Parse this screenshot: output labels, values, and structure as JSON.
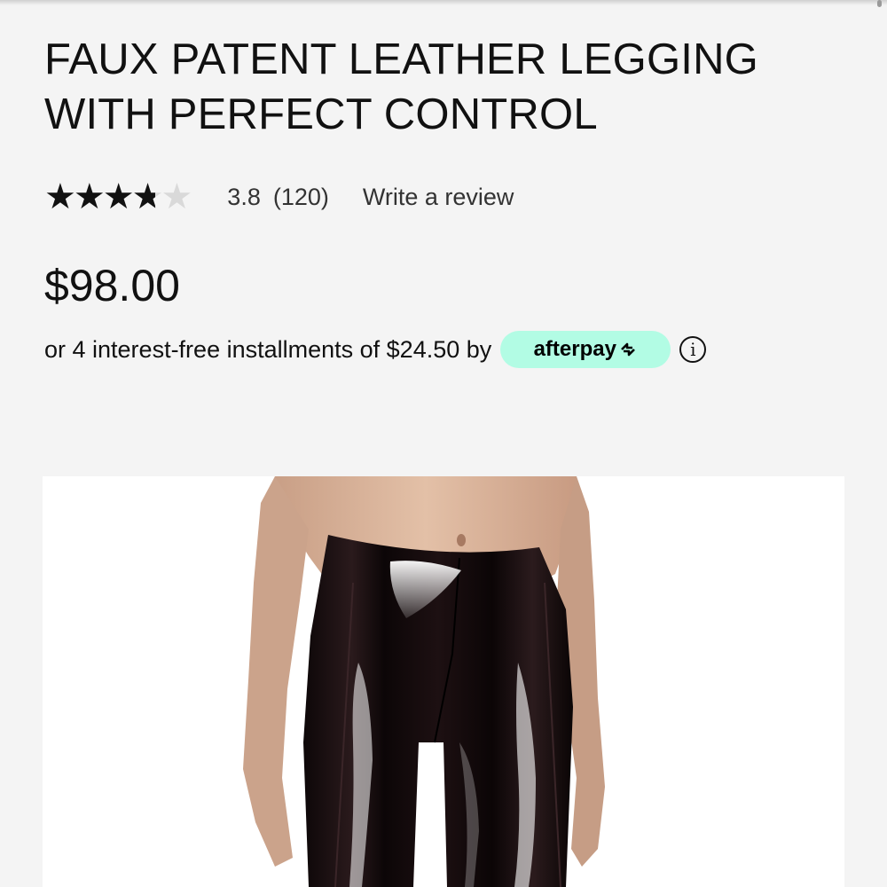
{
  "product": {
    "title": "FAUX PATENT LEATHER LEGGING WITH PERFECT CONTROL",
    "rating": {
      "value": "3.8",
      "count": "(120)",
      "stars_filled_fraction": 0.76,
      "write_review_label": "Write a review"
    },
    "price": "$98.00",
    "installments": {
      "text": "or 4 interest-free installments of $24.50 by",
      "provider_label": "afterpay",
      "provider_color": "#b2fce4",
      "info_icon": "info-icon"
    },
    "image": {
      "icon": "product-photo",
      "background": "#ffffff"
    }
  }
}
